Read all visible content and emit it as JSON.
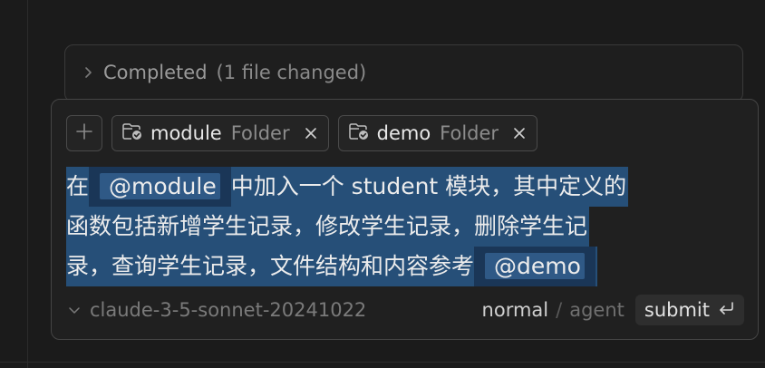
{
  "completed_panel": {
    "status": "Completed",
    "detail": "(1 file changed)"
  },
  "composer": {
    "chips": [
      {
        "name": "module",
        "kind": "Folder"
      },
      {
        "name": "demo",
        "kind": "Folder"
      }
    ],
    "message": {
      "line1_a": "在",
      "line1_mention": "@module",
      "line1_b": "中加入一个 student 模块，其中定义的",
      "line2": "函数包括新增学生记录，修改学生记录，删除学生记",
      "line3_a": "录，查询学生记录，文件结构和内容参考",
      "line3_mention": "@demo"
    },
    "footer": {
      "model": "claude-3-5-sonnet-20241022",
      "mode_active": "normal",
      "mode_separator": "/",
      "mode_inactive": "agent",
      "submit_label": "submit"
    }
  },
  "icons": {
    "add": "plus-icon",
    "folder": "folder-check-icon",
    "close": "close-icon",
    "expand": "chevron-right-icon",
    "model_dropdown": "chevron-down-icon",
    "submit": "enter-return-icon"
  },
  "colors": {
    "background": "#1b1b1b",
    "selection": "#264f78",
    "mention": "#2f5986"
  }
}
